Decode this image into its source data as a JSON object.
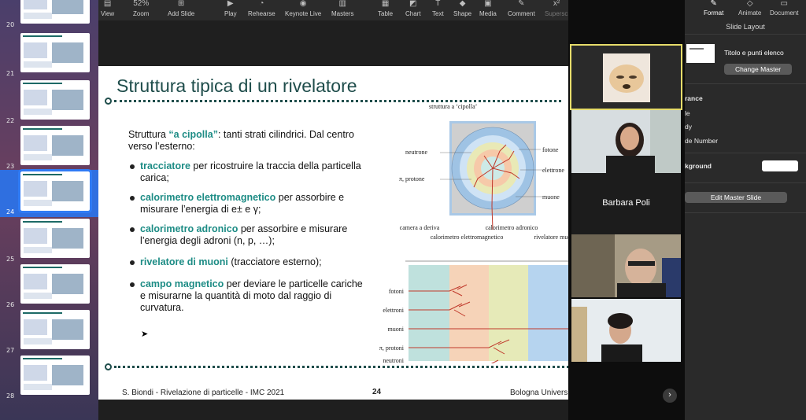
{
  "toolbar": {
    "zoom_value": "52%",
    "items": [
      {
        "label": "View",
        "icon": "view-icon"
      },
      {
        "label": "Zoom",
        "icon": "zoom-icon"
      },
      {
        "label": "Add Slide",
        "icon": "add-slide-icon"
      },
      {
        "label": "Play",
        "icon": "play-icon"
      },
      {
        "label": "Rehearse",
        "icon": "rehearse-icon"
      },
      {
        "label": "Keynote Live",
        "icon": "keynote-live-icon"
      },
      {
        "label": "Masters",
        "icon": "masters-icon"
      },
      {
        "label": "Table",
        "icon": "table-icon"
      },
      {
        "label": "Chart",
        "icon": "chart-icon"
      },
      {
        "label": "Text",
        "icon": "text-icon"
      },
      {
        "label": "Shape",
        "icon": "shape-icon"
      },
      {
        "label": "Media",
        "icon": "media-icon"
      },
      {
        "label": "Comment",
        "icon": "comment-icon"
      },
      {
        "label": "Superscript",
        "icon": "superscript-icon"
      }
    ]
  },
  "sidebar": {
    "slides": [
      {
        "number": "20"
      },
      {
        "number": "21"
      },
      {
        "number": "22"
      },
      {
        "number": "23"
      },
      {
        "number": "24",
        "active": true
      },
      {
        "number": "25"
      },
      {
        "number": "26"
      },
      {
        "number": "27"
      },
      {
        "number": "28"
      }
    ]
  },
  "slide": {
    "title": "Struttura tipica di un rivelatore",
    "intro_prefix": "Struttura ",
    "intro_highlight": "“a cipolla”",
    "intro_suffix": ": tanti strati cilindrici. Dal centro verso l’esterno:",
    "bullets": [
      {
        "highlight": "tracciatore",
        "text": " per ricostruire la traccia della particella carica;"
      },
      {
        "highlight": "calorimetro elettromagnetico",
        "text": " per assorbire e misurare l’energia di e± e γ;"
      },
      {
        "highlight": "calorimetro adronico",
        "text": " per assorbire e misurare l’energia degli adroni (n, p, …);"
      },
      {
        "highlight": "rivelatore di muoni",
        "text": " (tracciatore esterno);"
      },
      {
        "highlight": "campo magnetico",
        "text": " per deviare le particelle cariche e misurarne la quantità di moto dal raggio di curvatura."
      }
    ],
    "footer_left": "S. Biondi - Rivelazione di particelle - IMC 2021",
    "footer_page": "24",
    "footer_right": "Bologna University",
    "diagram": {
      "top_caption": "struttura a ‘cipolla’",
      "left_labels": [
        "neutrone",
        "π, protone"
      ],
      "right_labels": [
        "fotone",
        "elettrone",
        "muone"
      ],
      "column_headers": [
        "camera a deriva",
        "calorimetro elettromagnetico",
        "calorimetro adronico",
        "rivelatore muoni"
      ],
      "row_labels": [
        "fotoni",
        "elettroni",
        "muoni",
        "π, protoni",
        "neutroni"
      ]
    }
  },
  "video": {
    "participant_name": "Barbara Poli",
    "next_icon": "chevron-right-icon"
  },
  "inspector": {
    "tabs": [
      {
        "label": "Format",
        "icon": "format-icon"
      },
      {
        "label": "Animate",
        "icon": "animate-icon"
      },
      {
        "label": "Document",
        "icon": "document-icon"
      }
    ],
    "header": "Slide Layout",
    "layout_name": "Titolo e punti elenco",
    "change_master_label": "Change Master",
    "appearance_label": "rance",
    "check_title": "le",
    "check_body": "dy",
    "check_slide_number": "de Number",
    "background_label": "kground",
    "edit_master_label": "Edit Master Slide"
  }
}
